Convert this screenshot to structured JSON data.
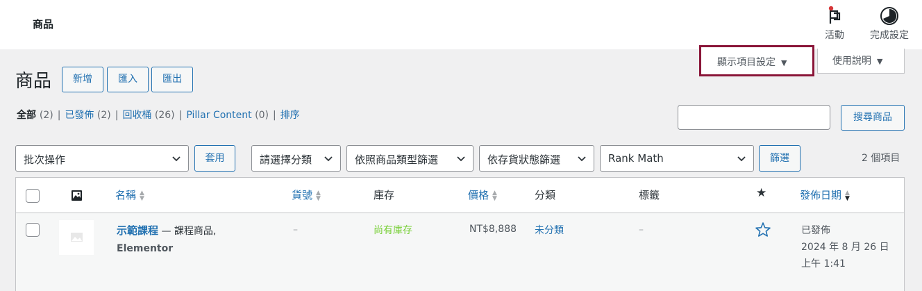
{
  "topbar": {
    "page_label": "商品",
    "activity_label": "活動",
    "setup_label": "完成設定"
  },
  "screen_options": {
    "label": "顯示項目設定"
  },
  "help": {
    "label": "使用說明"
  },
  "heading": {
    "title": "商品",
    "add_new": "新增",
    "import": "匯入",
    "export": "匯出"
  },
  "views": [
    {
      "label": "全部",
      "count": "(2)"
    },
    {
      "label": "已發佈",
      "count": "(2)"
    },
    {
      "label": "回收桶",
      "count": "(26)"
    },
    {
      "label": "Pillar Content",
      "count": "(0)"
    },
    {
      "label": "排序",
      "count": ""
    }
  ],
  "search": {
    "value": "",
    "placeholder": "",
    "button": "搜尋商品"
  },
  "filters": {
    "bulk_action": "批次操作",
    "apply": "套用",
    "category": "請選擇分類",
    "product_type": "依照商品類型篩選",
    "stock_status": "依存貨狀態篩選",
    "rank_math": "Rank Math",
    "filter_button": "篩選",
    "item_count": "2 個項目"
  },
  "columns": {
    "name": "名稱",
    "sku": "貨號",
    "stock": "庫存",
    "price": "價格",
    "categories": "分類",
    "tags": "標籤",
    "date": "發佈日期"
  },
  "rows": [
    {
      "name": "示範課程",
      "name_suffix": " — 課程商品,",
      "name_line2": "Elementor",
      "sku": "–",
      "stock": "尚有庫存",
      "price": "NT$8,888",
      "category": "未分類",
      "tags": "–",
      "status": "已發佈",
      "date": "2024 年 8 月 26 日",
      "time": "上午 1:41"
    }
  ],
  "colors": {
    "link": "#2271b1",
    "in_stock": "#7ad03a",
    "highlight_border": "#8a1538",
    "notification_dot": "#d63638"
  }
}
